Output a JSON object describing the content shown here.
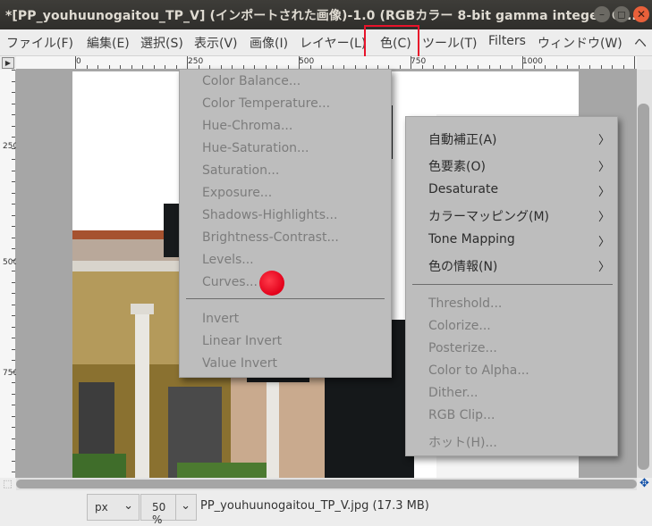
{
  "window": {
    "title": "*[PP_youhuunogaitou_TP_V] (インポートされた画像)-1.0 (RGBカラー 8-bit gamma integer, G...",
    "controls": [
      "–",
      "◻",
      "✕"
    ]
  },
  "menubar": {
    "items": [
      "ファイル(F)",
      "編集(E)",
      "選択(S)",
      "表示(V)",
      "画像(I)",
      "レイヤー(L)",
      "色(C)",
      "ツール(T)",
      "Filters",
      "ウィンドウ(W)",
      "ヘ"
    ]
  },
  "ruler": {
    "top_labels": [
      "0",
      "250",
      "500",
      "750",
      "1000"
    ],
    "left_labels": [
      "250",
      "500",
      "750"
    ]
  },
  "colors_menu": {
    "items": [
      "Color Balance...",
      "Color Temperature...",
      "Hue-Chroma...",
      "Hue-Saturation...",
      "Saturation...",
      "Exposure...",
      "Shadows-Highlights...",
      "Brightness-Contrast...",
      "Levels...",
      "Curves..."
    ],
    "items2": [
      "Invert",
      "Linear Invert",
      "Value Invert"
    ]
  },
  "submenu": {
    "items": [
      "自動補正(A)",
      "色要素(O)",
      "Desaturate",
      "カラーマッピング(M)",
      "Tone Mapping",
      "色の情報(N)"
    ],
    "items2": [
      "Threshold...",
      "Colorize...",
      "Posterize...",
      "Color to Alpha...",
      "Dither...",
      "RGB Clip...",
      "ホット(H)..."
    ]
  },
  "statusbar": {
    "unit": "px",
    "zoom": "50 %",
    "file": "PP_youhuunogaitou_TP_V.jpg (17.3 MB)"
  },
  "colors": {
    "highlight": "#e8132b",
    "menu_bg": "#bdbdbd",
    "cursor": "#e2001a"
  }
}
